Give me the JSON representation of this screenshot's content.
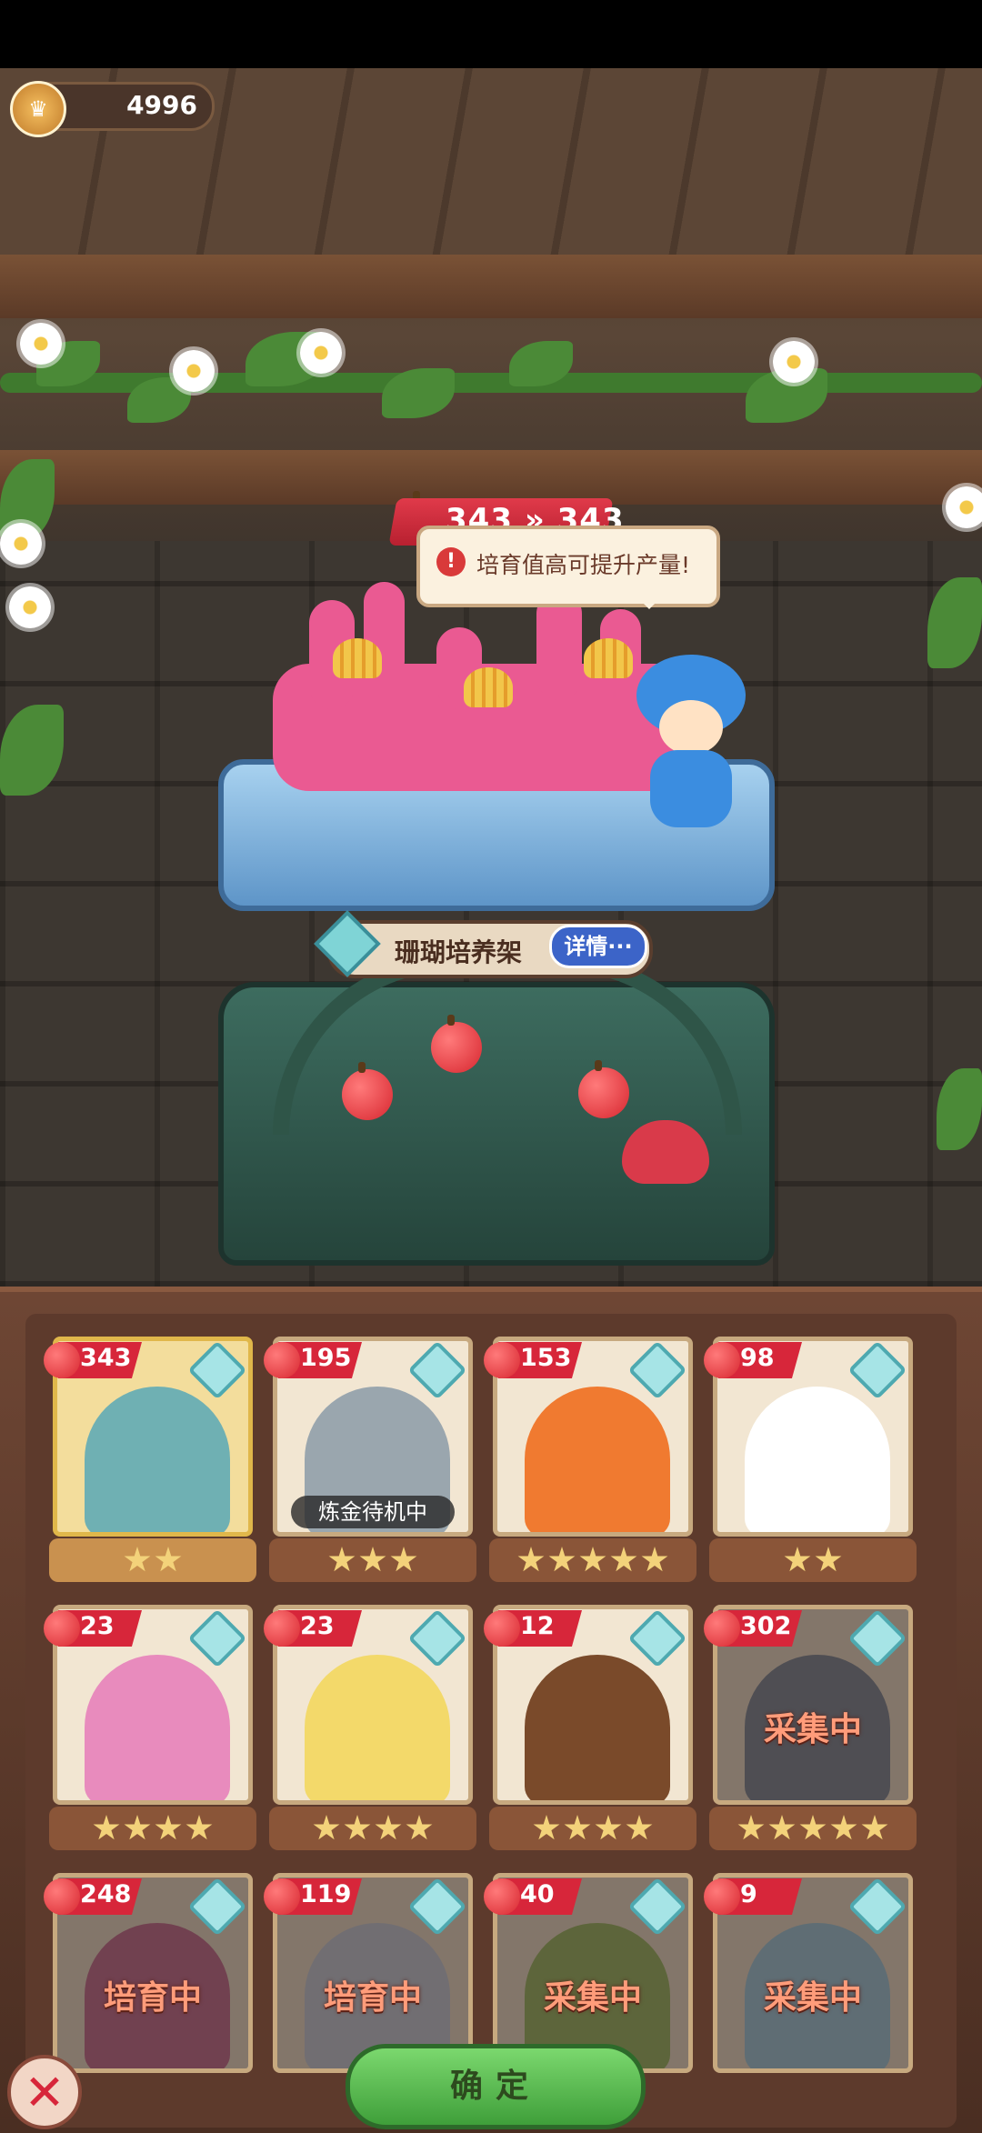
{
  "currency": {
    "icon": "crown-coin-icon",
    "value": "4996"
  },
  "production": {
    "from": "343",
    "arrow": "»",
    "to": "343"
  },
  "tip": {
    "text": "培育值高可提升产量!",
    "icon": "warning-icon"
  },
  "facility": {
    "name": "珊瑚培养架",
    "details_label": "详情···"
  },
  "colors": {
    "accent_red": "#d7263a",
    "confirm_green": "#4cae44",
    "panel_brown": "#5d3a2c"
  },
  "cards": [
    {
      "value": "343",
      "stars": 2,
      "badge": "",
      "status": "",
      "color": "#6fb0b3"
    },
    {
      "value": "195",
      "stars": 3,
      "badge": "炼金待机中",
      "status": "",
      "color": "#9aa6ae"
    },
    {
      "value": "153",
      "stars": 5,
      "badge": "",
      "status": "",
      "color": "#f07a30"
    },
    {
      "value": "98",
      "stars": 2,
      "badge": "",
      "status": "",
      "color": "#ffffff"
    },
    {
      "value": "23",
      "stars": 4,
      "badge": "",
      "status": "",
      "color": "#e88bbd"
    },
    {
      "value": "23",
      "stars": 4,
      "badge": "",
      "status": "",
      "color": "#f3d96a"
    },
    {
      "value": "12",
      "stars": 4,
      "badge": "",
      "status": "",
      "color": "#7a4a2a"
    },
    {
      "value": "302",
      "stars": 5,
      "badge": "",
      "status": "采集中",
      "color": "#7f8fa0"
    },
    {
      "value": "248",
      "stars": 0,
      "badge": "",
      "status": "培育中",
      "color": "#c9729a"
    },
    {
      "value": "119",
      "stars": 0,
      "badge": "",
      "status": "培育中",
      "color": "#c9d6e4"
    },
    {
      "value": "40",
      "stars": 0,
      "badge": "",
      "status": "采集中",
      "color": "#9ec26a"
    },
    {
      "value": "9",
      "stars": 0,
      "badge": "",
      "status": "采集中",
      "color": "#a3d3e8"
    }
  ],
  "buttons": {
    "close_icon": "close-icon",
    "close": "✕",
    "confirm": "确定"
  }
}
